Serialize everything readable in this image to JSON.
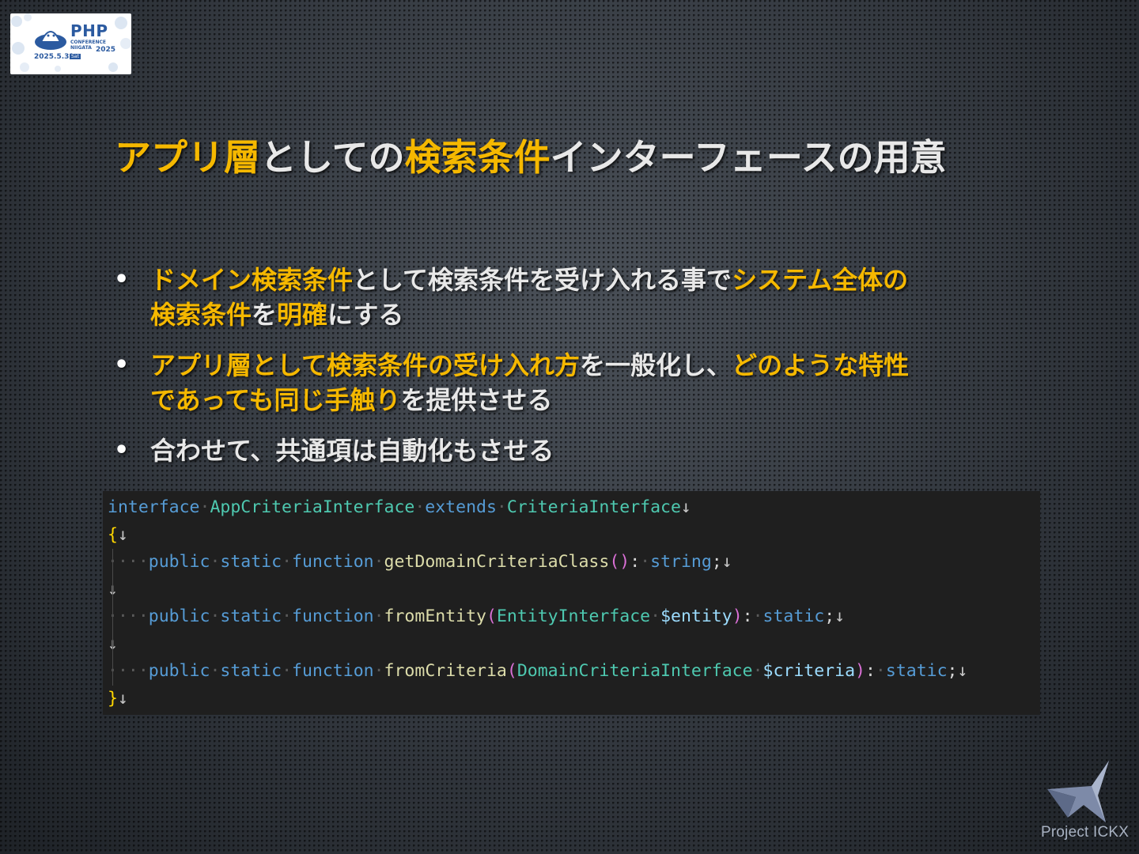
{
  "logo": {
    "brand_text": "PHP",
    "conference_text": "CONFERENCE\nNIIGATA",
    "year": "2025",
    "date": "2025.5.31",
    "day": "Sat"
  },
  "title": {
    "parts": [
      {
        "text": "アプリ層",
        "highlight": true
      },
      {
        "text": "としての",
        "highlight": false
      },
      {
        "text": "検索条件",
        "highlight": true
      },
      {
        "text": "インターフェースの用意",
        "highlight": false
      }
    ]
  },
  "bullets": [
    {
      "line1": [
        {
          "text": "ドメイン検索条件",
          "highlight": true
        },
        {
          "text": "として検索条件を受け入れる事で",
          "highlight": false
        },
        {
          "text": "システム全体の",
          "highlight": true
        }
      ],
      "line2": [
        {
          "text": "検索条件",
          "highlight": true
        },
        {
          "text": "を",
          "highlight": false
        },
        {
          "text": "明確",
          "highlight": true
        },
        {
          "text": "にする",
          "highlight": false
        }
      ]
    },
    {
      "line1": [
        {
          "text": "アプリ層として検索条件の受け入れ方",
          "highlight": true
        },
        {
          "text": "を一般化し、",
          "highlight": false
        },
        {
          "text": "どのような特性",
          "highlight": true
        }
      ],
      "line2": [
        {
          "text": "であっても同じ手触り",
          "highlight": true
        },
        {
          "text": "を提供させる",
          "highlight": false
        }
      ]
    },
    {
      "line1": [
        {
          "text": "合わせて、共通項は自動化もさせる",
          "highlight": false
        }
      ],
      "line2": []
    }
  ],
  "code": {
    "lines": [
      [
        [
          "kw",
          "interface"
        ],
        [
          "ws",
          "·"
        ],
        [
          "ty",
          "AppCriteriaInterface"
        ],
        [
          "ws",
          "·"
        ],
        [
          "kw",
          "extends"
        ],
        [
          "ws",
          "·"
        ],
        [
          "ty",
          "CriteriaInterface"
        ],
        [
          "nl",
          "↓"
        ]
      ],
      [
        [
          "br1",
          "{"
        ],
        [
          "nl",
          "↓"
        ]
      ],
      [
        [
          "ws",
          "····"
        ],
        [
          "kw",
          "public"
        ],
        [
          "ws",
          "·"
        ],
        [
          "kw",
          "static"
        ],
        [
          "ws",
          "·"
        ],
        [
          "kw",
          "function"
        ],
        [
          "ws",
          "·"
        ],
        [
          "fn",
          "getDomainCriteriaClass"
        ],
        [
          "br2",
          "()"
        ],
        [
          "pun",
          ":"
        ],
        [
          "ws",
          "·"
        ],
        [
          "kw",
          "string"
        ],
        [
          "pun",
          ";"
        ],
        [
          "nl",
          "↓"
        ]
      ],
      [
        [
          "nl",
          "↓"
        ]
      ],
      [
        [
          "ws",
          "····"
        ],
        [
          "kw",
          "public"
        ],
        [
          "ws",
          "·"
        ],
        [
          "kw",
          "static"
        ],
        [
          "ws",
          "·"
        ],
        [
          "kw",
          "function"
        ],
        [
          "ws",
          "·"
        ],
        [
          "fn",
          "fromEntity"
        ],
        [
          "br2",
          "("
        ],
        [
          "ty",
          "EntityInterface"
        ],
        [
          "ws",
          "·"
        ],
        [
          "var",
          "$entity"
        ],
        [
          "br2",
          ")"
        ],
        [
          "pun",
          ":"
        ],
        [
          "ws",
          "·"
        ],
        [
          "kw",
          "static"
        ],
        [
          "pun",
          ";"
        ],
        [
          "nl",
          "↓"
        ]
      ],
      [
        [
          "nl",
          "↓"
        ]
      ],
      [
        [
          "ws",
          "····"
        ],
        [
          "kw",
          "public"
        ],
        [
          "ws",
          "·"
        ],
        [
          "kw",
          "static"
        ],
        [
          "ws",
          "·"
        ],
        [
          "kw",
          "function"
        ],
        [
          "ws",
          "·"
        ],
        [
          "fn",
          "fromCriteria"
        ],
        [
          "br2",
          "("
        ],
        [
          "ty",
          "DomainCriteriaInterface"
        ],
        [
          "ws",
          "·"
        ],
        [
          "var",
          "$criteria"
        ],
        [
          "br2",
          ")"
        ],
        [
          "pun",
          ":"
        ],
        [
          "ws",
          "·"
        ],
        [
          "kw",
          "static"
        ],
        [
          "pun",
          ";"
        ],
        [
          "nl",
          "↓"
        ]
      ],
      [
        [
          "br1",
          "}"
        ],
        [
          "nl",
          "↓"
        ]
      ]
    ]
  },
  "brand": {
    "label": "Project ICKX"
  },
  "colors": {
    "highlight": "#f5b800",
    "normal_text": "#e8e8e8",
    "code_background": "#1f1f1f"
  }
}
